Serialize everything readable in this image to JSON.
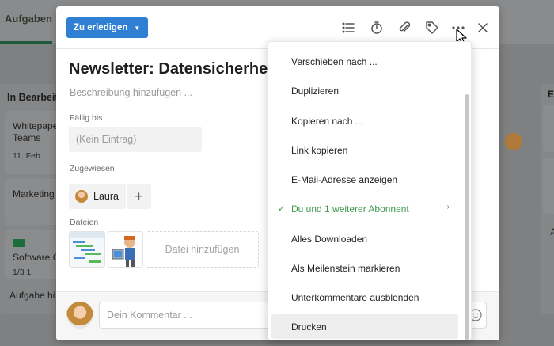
{
  "background": {
    "tab_label": "Aufgaben",
    "column_left_title": "In Bearbeit",
    "cards": [
      {
        "text": "Whitepape",
        "line2": "Teams",
        "meta": "11. Feb"
      },
      {
        "text": "Marketing"
      },
      {
        "text": "Software C",
        "meta": "1/3  1"
      }
    ],
    "add_task": "Aufgabe hi",
    "right_column_title": "E",
    "right_column_letter": "A"
  },
  "header": {
    "status_label": "Zu erledigen",
    "icons": [
      "checklist-icon",
      "timer-icon",
      "paperclip-icon",
      "tag-icon",
      "more-icon",
      "close-icon"
    ]
  },
  "task": {
    "title": "Newsletter: Datensicherheit",
    "description_placeholder": "Beschreibung hinzufügen ...",
    "due_label": "Fällig bis",
    "due_value": "(Kein Eintrag)",
    "assigned_label": "Zugewiesen",
    "assignee_name": "Laura",
    "add_assignee": "+",
    "files_label": "Dateien",
    "add_file": "Datei hinzufügen"
  },
  "comment": {
    "placeholder": "Dein Kommentar ..."
  },
  "menu": {
    "items": [
      {
        "label": "Verschieben nach ..."
      },
      {
        "label": "Duplizieren"
      },
      {
        "label": "Kopieren nach ..."
      },
      {
        "label": "Link kopieren"
      },
      {
        "label": "E-Mail-Adresse anzeigen"
      },
      {
        "label": "Du und 1 weiterer Abonnent",
        "active": true,
        "check": "✓",
        "arrow": "›"
      },
      {
        "label": "Alles Downloaden"
      },
      {
        "label": "Als Meilenstein markieren"
      },
      {
        "label": "Unterkommentare ausblenden"
      },
      {
        "label": "Drucken",
        "hover": true
      }
    ]
  },
  "colors": {
    "status_button": "#2f7fd2",
    "active_menu_item": "#3f9a4d",
    "overlay": "#7f8081"
  }
}
